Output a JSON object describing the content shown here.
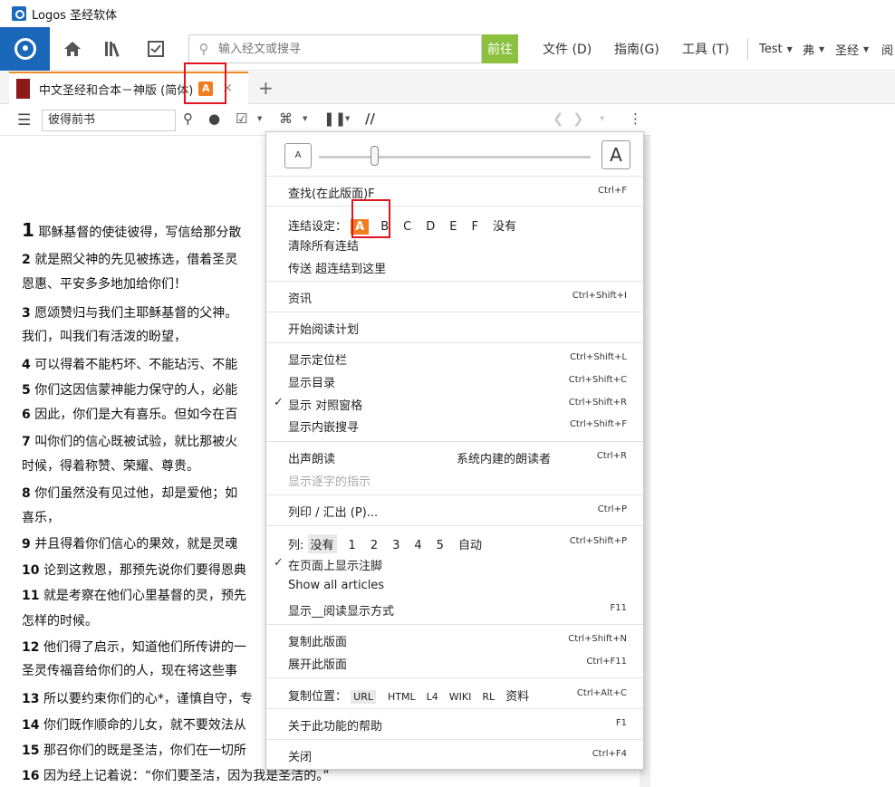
{
  "window": {
    "title": "Logos 圣经软体"
  },
  "toolbar": {
    "search_placeholder": "输入经文或搜寻",
    "go_label": "前往",
    "menus": [
      "文件 (D)",
      "指南(G)",
      "工具 (T)"
    ],
    "user": "Test",
    "lang": "弗",
    "bible": "圣经",
    "more": "阅"
  },
  "tab": {
    "label": "中文圣经和合本－神版 (简体)",
    "badge": "A"
  },
  "panel": {
    "reference": "彼得前书",
    "parallel_label": "//"
  },
  "verses": [
    {
      "n": "1",
      "text": "耶稣基督的使徒彼得，写信给那分散"
    },
    {
      "n": "2",
      "text": "就是照父神的先见被拣选，借着圣灵"
    },
    {
      "n": "",
      "text": "恩惠、平安多多地加给你们！"
    },
    {
      "n": "3",
      "text": "愿颂赞归与我们主耶稣基督的父神。"
    },
    {
      "n": "",
      "text": "我们，叫我们有活泼的盼望，"
    },
    {
      "n": "4",
      "text": "可以得着不能朽坏、不能玷污、不能"
    },
    {
      "n": "5",
      "text": "你们这因信蒙神能力保守的人，必能"
    },
    {
      "n": "6",
      "text": "因此，你们是大有喜乐。但如今在百"
    },
    {
      "n": "7",
      "text": "叫你们的信心既被试验，就比那被火"
    },
    {
      "n": "",
      "text": "时候，得着称赞、荣耀、尊贵。"
    },
    {
      "n": "8",
      "text": "你们虽然没有见过他，却是爱他；如"
    },
    {
      "n": "",
      "text": "喜乐，"
    },
    {
      "n": "9",
      "text": "并且得着你们信心的果效，就是灵魂"
    },
    {
      "n": "10",
      "text": "论到这救恩，那预先说你们要得恩典"
    },
    {
      "n": "11",
      "text": "就是考察在他们心里基督的灵，预先"
    },
    {
      "n": "",
      "text": "怎样的时候。"
    },
    {
      "n": "12",
      "text": "他们得了启示，知道他们所传讲的一"
    },
    {
      "n": "",
      "text": "圣灵传福音给你们的人，现在将这些事"
    },
    {
      "n": "13",
      "text": "所以要约束你们的心*，谨慎自守，专"
    },
    {
      "n": "14",
      "text": "你们既作顺命的儿女，就不要效法从"
    },
    {
      "n": "15",
      "text": "那召你们的既是圣洁，你们在一切所"
    },
    {
      "n": "16",
      "text": "因为经上记着说：“你们要圣洁，因为我是圣洁的。”"
    }
  ],
  "menu": {
    "font_small": "A",
    "font_big": "A",
    "find": {
      "label": "查找(在此版面)F",
      "shortcut": "Ctrl+F"
    },
    "link_set": {
      "label": "连结设定：",
      "options": [
        "A",
        "B",
        "C",
        "D",
        "E",
        "F",
        "没有"
      ]
    },
    "clear_links": "清除所有连结",
    "send_hyperlink": "传送 超连结到这里",
    "info": {
      "label": "资讯",
      "shortcut": "Ctrl+Shift+I"
    },
    "reading_plan": "开始阅读计划",
    "show_locator": {
      "label": "显示定位栏",
      "shortcut": "Ctrl+Shift+L"
    },
    "show_toc": {
      "label": "显示目录",
      "shortcut": "Ctrl+Shift+C"
    },
    "show_parallel": {
      "label": "显示 对照窗格",
      "shortcut": "Ctrl+Shift+R"
    },
    "show_inline_search": {
      "label": "显示内嵌搜寻",
      "shortcut": "Ctrl+Shift+F"
    },
    "read_aloud": {
      "label": "出声朗读",
      "voice": "系统内建的朗读者",
      "shortcut": "Ctrl+R"
    },
    "show_word_pointer": "显示逐字的指示",
    "print_export": {
      "label": "列印 / 汇出 (P)...",
      "shortcut": "Ctrl+P"
    },
    "columns": {
      "label": "列:",
      "options": [
        "没有",
        "1",
        "2",
        "3",
        "4",
        "5",
        "自动"
      ],
      "shortcut": "Ctrl+Shift+P"
    },
    "show_footnotes": "在页面上显示注脚",
    "show_all_articles": "Show all articles",
    "reading_view": {
      "label": "显示__阅读显示方式",
      "shortcut": "F11"
    },
    "duplicate_panel": {
      "label": "复制此版面",
      "shortcut": "Ctrl+Shift+N"
    },
    "expand_panel": {
      "label": "展开此版面",
      "shortcut": "Ctrl+F11"
    },
    "copy_location": {
      "label": "复制位置：",
      "options": [
        "URL",
        "HTML",
        "L4",
        "WIKI",
        "RL",
        "资料"
      ],
      "shortcut": "Ctrl+Alt+C"
    },
    "help": {
      "label": "关于此功能的帮助",
      "shortcut": "F1"
    },
    "close": {
      "label": "关闭",
      "shortcut": "Ctrl+F4"
    }
  }
}
